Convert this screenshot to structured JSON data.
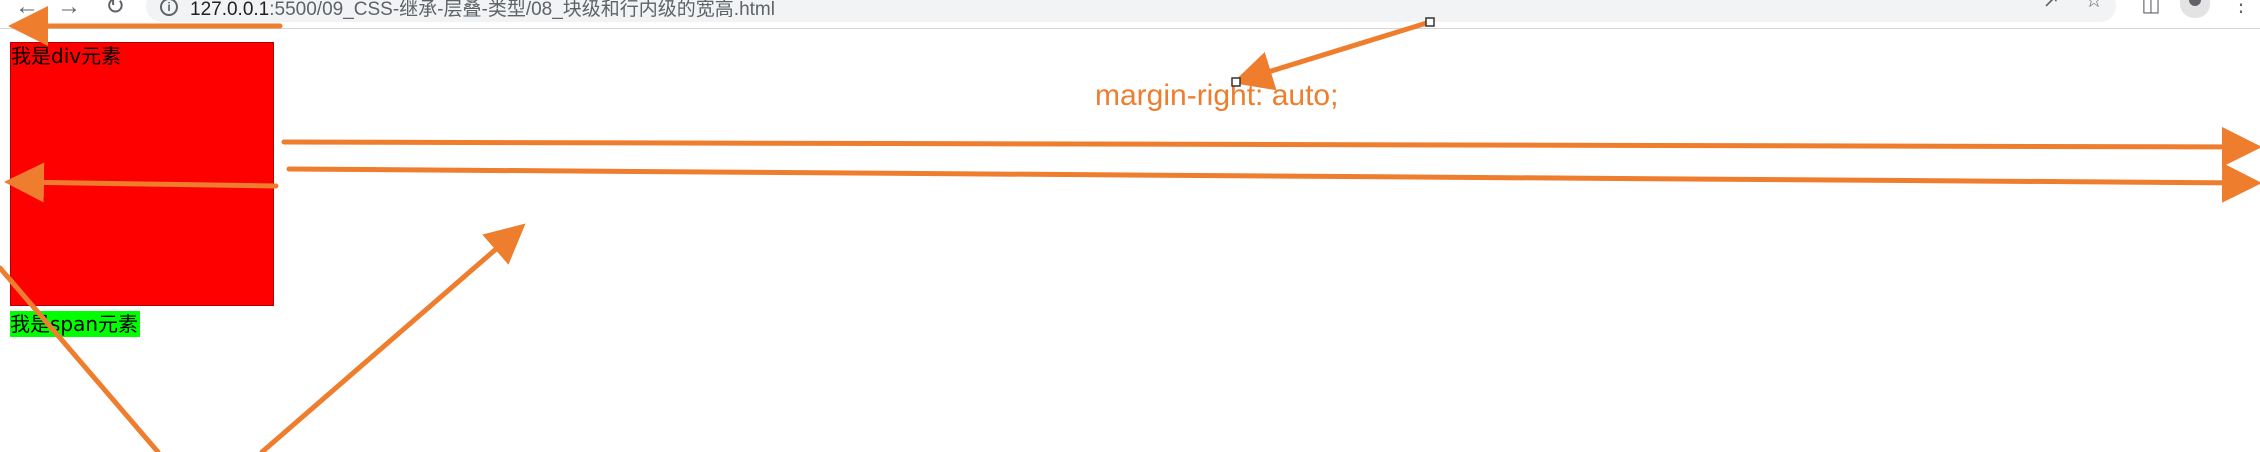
{
  "browser": {
    "url_host": "127.0.0.1",
    "url_rest": ":5500/09_CSS-继承-层叠-类型/08_块级和行内级的宽高.html",
    "icons": [
      "back-icon",
      "forward-icon",
      "reload-icon",
      "info-icon",
      "share-icon",
      "star-icon",
      "side-panel-icon",
      "profile-icon",
      "menu-icon"
    ]
  },
  "page": {
    "div_text": "我是div元素",
    "span_text": "我是span元素",
    "div_color": "#ff0000",
    "span_color": "#00ff00"
  },
  "annotation": {
    "text": "margin-right: auto;",
    "color": "#ee7d2d"
  }
}
